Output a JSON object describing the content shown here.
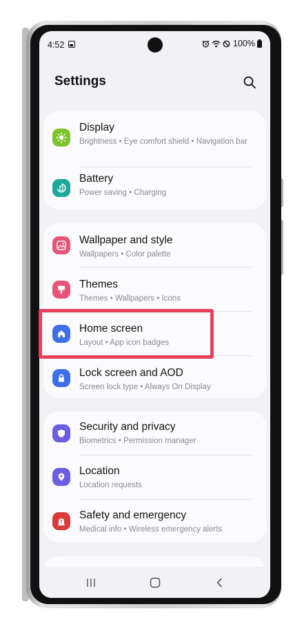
{
  "status_bar": {
    "time": "4:52",
    "battery_percent": "100%",
    "icons": [
      "gallery-icon",
      "alarm-icon",
      "wifi-icon",
      "do-not-disturb-icon",
      "battery-icon"
    ]
  },
  "header": {
    "title": "Settings",
    "search_icon": "search-icon"
  },
  "settings_groups": [
    {
      "items": [
        {
          "title": "Display",
          "subtitle": "Brightness • Eye comfort shield • Navigation bar",
          "icon": "display-sun-icon",
          "icon_color": "#7bc42a"
        },
        {
          "title": "Battery",
          "subtitle": "Power saving • Charging",
          "icon": "battery-cycle-icon",
          "icon_color": "#1fa89a"
        }
      ]
    },
    {
      "items": [
        {
          "title": "Wallpaper and style",
          "subtitle": "Wallpapers • Color palette",
          "icon": "wallpaper-icon",
          "icon_color": "#e85478"
        },
        {
          "title": "Themes",
          "subtitle": "Themes • Wallpapers • Icons",
          "icon": "themes-brush-icon",
          "icon_color": "#e85478"
        },
        {
          "title": "Home screen",
          "subtitle": "Layout • App icon badges",
          "icon": "home-icon",
          "icon_color": "#3d6fe6",
          "highlighted": true
        },
        {
          "title": "Lock screen and AOD",
          "subtitle": "Screen lock type • Always On Display",
          "icon": "lock-icon",
          "icon_color": "#3d6fe6"
        }
      ]
    },
    {
      "items": [
        {
          "title": "Security and privacy",
          "subtitle": "Biometrics • Permission manager",
          "icon": "shield-icon",
          "icon_color": "#6a5fe0"
        },
        {
          "title": "Location",
          "subtitle": "Location requests",
          "icon": "location-pin-icon",
          "icon_color": "#6a5fe0"
        },
        {
          "title": "Safety and emergency",
          "subtitle": "Medical info • Wireless emergency alerts",
          "icon": "emergency-icon",
          "icon_color": "#d93a3a"
        }
      ]
    }
  ],
  "highlight_color": "#e8405a",
  "nav_bar": {
    "icons": [
      "recent-apps-icon",
      "home-button-icon",
      "back-icon"
    ]
  }
}
